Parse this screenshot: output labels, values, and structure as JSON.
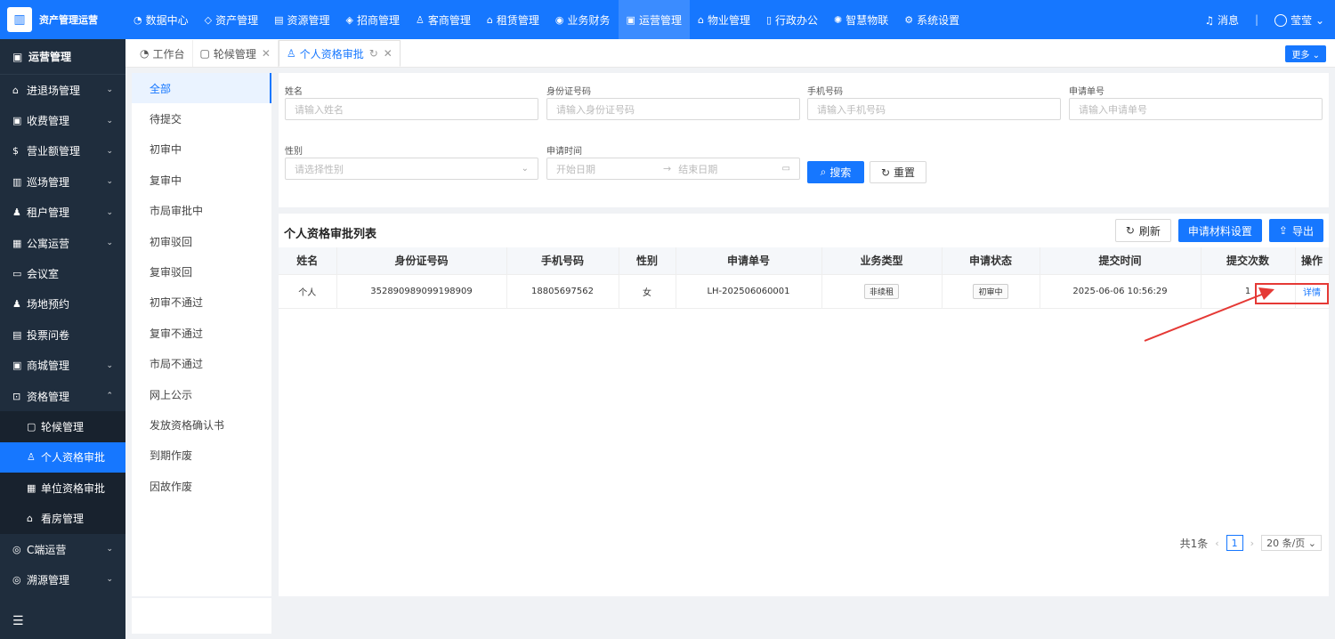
{
  "app": {
    "title": "资产管理运营"
  },
  "topnav": [
    {
      "label": "数据中心",
      "icon": "◔"
    },
    {
      "label": "资产管理",
      "icon": "◇"
    },
    {
      "label": "资源管理",
      "icon": "▤"
    },
    {
      "label": "招商管理",
      "icon": "◈"
    },
    {
      "label": "客商管理",
      "icon": "♙"
    },
    {
      "label": "租赁管理",
      "icon": "⌂"
    },
    {
      "label": "业务财务",
      "icon": "◉"
    },
    {
      "label": "运营管理",
      "icon": "▣",
      "active": true
    },
    {
      "label": "物业管理",
      "icon": "⌂"
    },
    {
      "label": "行政办公",
      "icon": "▯"
    },
    {
      "label": "智慧物联",
      "icon": "✺"
    },
    {
      "label": "系统设置",
      "icon": "⚙"
    }
  ],
  "topright": {
    "messages": "消息",
    "user": "莹莹"
  },
  "sidebar": {
    "header": "运营管理",
    "items": [
      {
        "label": "进退场管理",
        "icon": "⌂",
        "expandable": true
      },
      {
        "label": "收费管理",
        "icon": "▣",
        "expandable": true
      },
      {
        "label": "营业额管理",
        "icon": "$",
        "expandable": true
      },
      {
        "label": "巡场管理",
        "icon": "▥",
        "expandable": true
      },
      {
        "label": "租户管理",
        "icon": "♟",
        "expandable": true
      },
      {
        "label": "公寓运营",
        "icon": "▦",
        "expandable": true
      },
      {
        "label": "会议室",
        "icon": "▭",
        "expandable": false
      },
      {
        "label": "场地预约",
        "icon": "♟",
        "expandable": false
      },
      {
        "label": "投票问卷",
        "icon": "▤",
        "expandable": false
      },
      {
        "label": "商城管理",
        "icon": "▣",
        "expandable": true
      },
      {
        "label": "资格管理",
        "icon": "⊡",
        "expandable": true,
        "expanded": true
      }
    ],
    "subitems": [
      {
        "label": "轮候管理",
        "icon": "▢"
      },
      {
        "label": "个人资格审批",
        "icon": "♙",
        "active": true
      },
      {
        "label": "单位资格审批",
        "icon": "▦"
      },
      {
        "label": "看房管理",
        "icon": "⌂"
      }
    ],
    "items_after": [
      {
        "label": "C端运营",
        "icon": "◎",
        "expandable": true
      },
      {
        "label": "溯源管理",
        "icon": "◎",
        "expandable": true
      }
    ]
  },
  "tabs": [
    {
      "label": "工作台",
      "icon": "◔"
    },
    {
      "label": "轮候管理",
      "icon": "▢",
      "closable": true
    },
    {
      "label": "个人资格审批",
      "icon": "♙",
      "active": true,
      "closable": true
    }
  ],
  "more_label": "更多",
  "status_list": [
    "全部",
    "待提交",
    "初审中",
    "复审中",
    "市局审批中",
    "初审驳回",
    "复审驳回",
    "初审不通过",
    "复审不通过",
    "市局不通过",
    "网上公示",
    "发放资格确认书",
    "到期作废",
    "因故作废"
  ],
  "filter": {
    "name_label": "姓名",
    "name_placeholder": "请输入姓名",
    "id_label": "身份证号码",
    "id_placeholder": "请输入身份证号码",
    "phone_label": "手机号码",
    "phone_placeholder": "请输入手机号码",
    "appno_label": "申请单号",
    "appno_placeholder": "请输入申请单号",
    "gender_label": "性别",
    "gender_placeholder": "请选择性别",
    "time_label": "申请时间",
    "start_placeholder": "开始日期",
    "end_placeholder": "结束日期",
    "search_label": "搜索",
    "reset_label": "重置"
  },
  "table": {
    "title": "个人资格审批列表",
    "refresh_label": "刷新",
    "settings_label": "申请材料设置",
    "export_label": "导出",
    "columns": [
      "姓名",
      "身份证号码",
      "手机号码",
      "性别",
      "申请单号",
      "业务类型",
      "申请状态",
      "提交时间",
      "提交次数",
      "操作"
    ],
    "rows": [
      {
        "name": "个人",
        "id": "352890989099198909",
        "phone": "18805697562",
        "gender": "女",
        "appno": "LH-202506060001",
        "type": "非续租",
        "status": "初审中",
        "time": "2025-06-06 10:56:29",
        "count": "1",
        "action": "详情"
      }
    ]
  },
  "pager": {
    "total": "共1条",
    "page": "1",
    "size": "20 条/页"
  },
  "colors": {
    "primary": "#1677ff",
    "sidebar": "#1f2d3d",
    "annotation": "#e53935"
  }
}
